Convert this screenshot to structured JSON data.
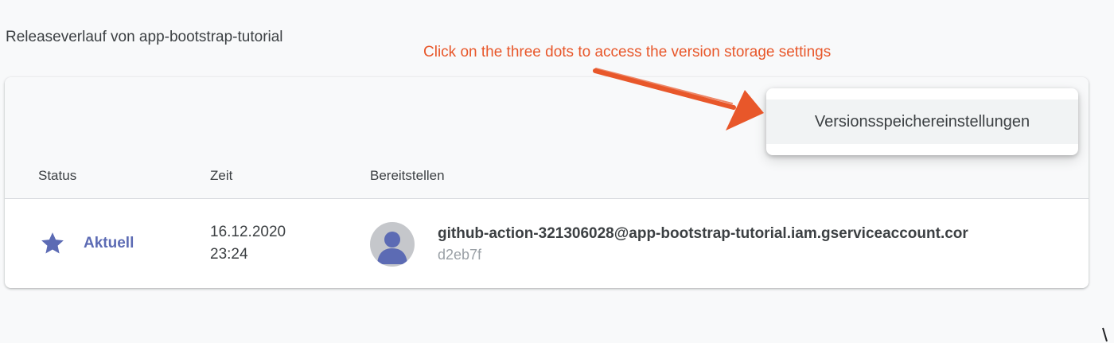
{
  "page": {
    "title": "Releaseverlauf von app-bootstrap-tutorial"
  },
  "annotation": {
    "text": "Click on the three dots to access the version storage settings",
    "color": "#e8572a"
  },
  "menu": {
    "items": [
      {
        "label": "Versionsspeichereinstellungen"
      }
    ]
  },
  "table": {
    "columns": [
      "Status",
      "Zeit",
      "Bereitstellen"
    ],
    "rows": [
      {
        "status_icon": "star-icon",
        "status": "Aktuell",
        "time_date": "16.12.2020",
        "time_clock": "23:24",
        "avatar_icon": "user-avatar-icon",
        "account": "github-action-321306028@app-bootstrap-tutorial.iam.gserviceaccount.cor",
        "hash": "d2eb7f"
      }
    ]
  },
  "colors": {
    "status_accent": "#5c6bb4",
    "avatar_bg": "#c5c7cb",
    "avatar_fg": "#5c6bb4"
  }
}
